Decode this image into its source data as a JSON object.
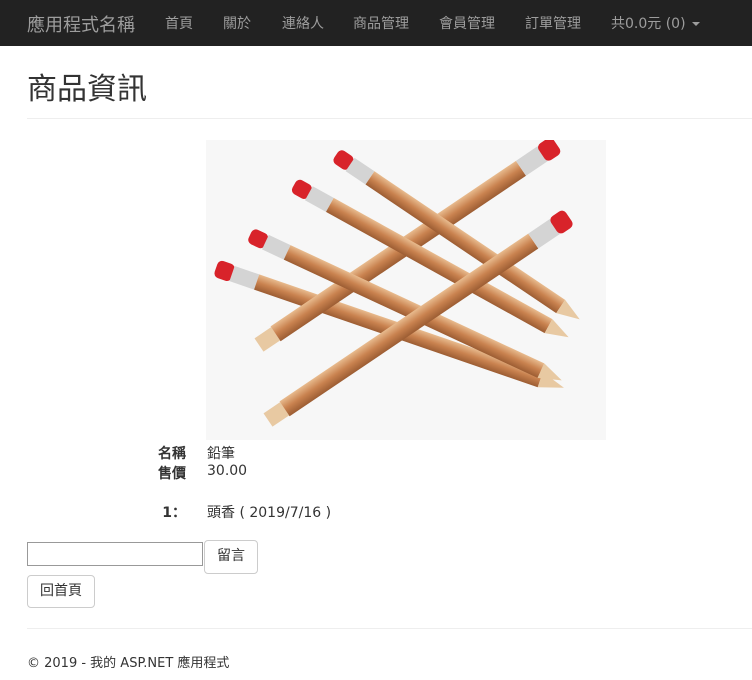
{
  "navbar": {
    "brand": "應用程式名稱",
    "items": [
      "首頁",
      "關於",
      "連絡人",
      "商品管理",
      "會員管理",
      "訂單管理"
    ],
    "cart": "共0.0元 (0)"
  },
  "page": {
    "title": "商品資訊"
  },
  "product": {
    "image": "pencil-photo",
    "name_label": "名稱",
    "name_value": "鉛筆",
    "price_label": "售價",
    "price_value": "30.00"
  },
  "comments": [
    {
      "index": "1：",
      "text": "頭香 ( 2019/7/16 )"
    }
  ],
  "form": {
    "input_value": "",
    "submit_label": "留言",
    "home_label": "回首頁"
  },
  "footer": {
    "text": "© 2019 - 我的 ASP.NET 應用程式"
  }
}
